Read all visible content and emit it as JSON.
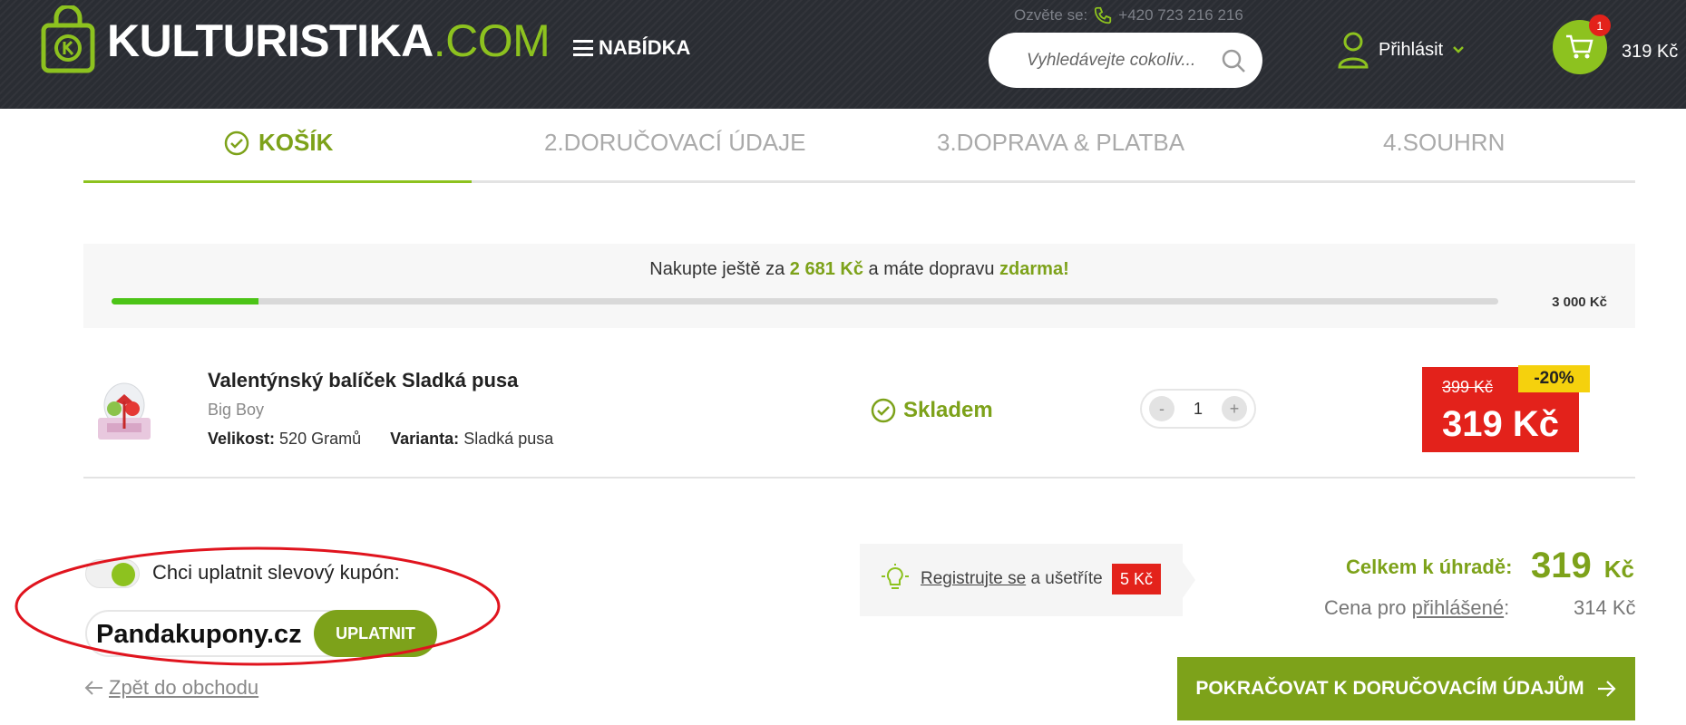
{
  "header": {
    "logo_main": "KULTURISTIKA",
    "logo_suffix": ".COM",
    "menu_label": "NABÍDKA",
    "phone_prefix": "Ozvěte se:",
    "phone_number": "+420 723 216 216",
    "search_placeholder": "Vyhledávejte cokoliv...",
    "login_label": "Přihlásit",
    "cart_count": "1",
    "cart_total": "319 Kč"
  },
  "steps": [
    {
      "label": "KOŠÍK",
      "active": true
    },
    {
      "label": "2.DORUČOVACÍ ÚDAJE"
    },
    {
      "label": "3.DOPRAVA & PLATBA"
    },
    {
      "label": "4.SOUHRN"
    }
  ],
  "shipping": {
    "text_before": "Nakupte ještě za ",
    "remaining": "2 681 Kč",
    "text_middle": " a máte dopravu ",
    "free": "zdarma!",
    "threshold": "3 000 Kč",
    "progress_fraction": 0.106
  },
  "product": {
    "name": "Valentýnský balíček Sladká pusa",
    "brand": "Big Boy",
    "size_label": "Velikost:",
    "size_value": "520 Gramů",
    "variant_label": "Varianta:",
    "variant_value": "Sladká pusa",
    "stock": "Skladem",
    "quantity": "1",
    "qty_minus": "-",
    "qty_plus": "+",
    "price_old": "399 Kč",
    "price_new": "319 Kč",
    "discount": "-20%"
  },
  "coupon": {
    "label": "Chci uplatnit slevový kupón:",
    "value": "Pandakupony.cz",
    "apply_label": "UPLATNIT"
  },
  "back_link": "Zpět do obchodu",
  "register": {
    "link": "Registrujte se",
    "text": " a ušetříte",
    "saving": "5 Kč"
  },
  "totals": {
    "total_label": "Celkem k úhradě:",
    "total_amount": "319",
    "total_currency": "Kč",
    "logged_prefix": "Cena pro ",
    "logged_link": "přihlášené",
    "logged_suffix": ":",
    "logged_value": "314 Kč"
  },
  "continue_label": "POKRAČOVAT K DORUČOVACÍM ÚDAJŮM",
  "colors": {
    "brand_green": "#8dc21f",
    "text_green": "#7da21a",
    "header_bg": "#2a2d33",
    "sale_red": "#e3221b",
    "badge_yellow": "#f5d10d",
    "annotation_red": "#e0141e"
  },
  "icons": [
    "shopping-bag-logo-icon",
    "menu-icon",
    "phone-icon",
    "search-icon",
    "user-icon",
    "chevron-down-icon",
    "cart-icon",
    "check-circle-icon",
    "trash-icon",
    "lightbulb-icon",
    "arrow-left-icon",
    "arrow-right-icon"
  ]
}
